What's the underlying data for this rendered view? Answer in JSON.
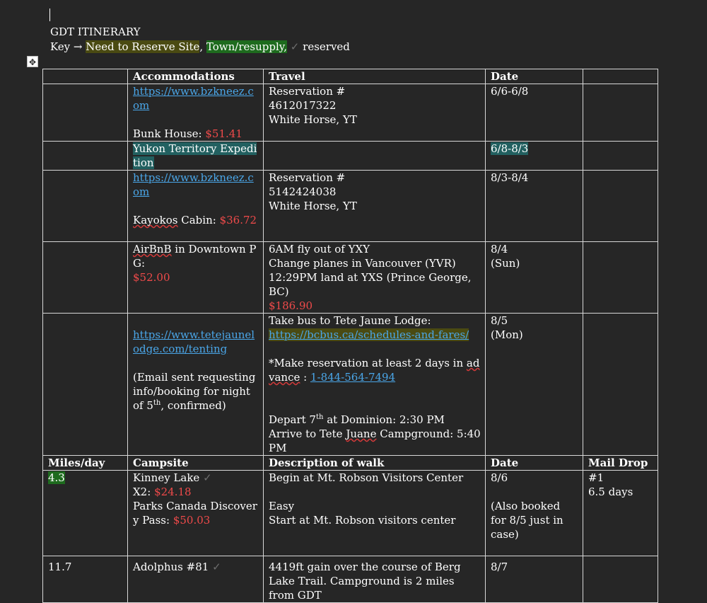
{
  "doc": {
    "title": "GDT ITINERARY",
    "key_prefix": "Key → ",
    "key_reserve": "Need to Reserve Site",
    "key_town": "Town/resupply,",
    "key_check": "✓",
    "key_reserved": "reserved",
    "comma": ","
  },
  "headers1": {
    "col2": "Accommodations",
    "col3": "Travel",
    "col4": "Date"
  },
  "rows1": [
    {
      "accom_link": "https://www.bzkneez.com",
      "accom_label": "Bunk House:",
      "accom_price": "$51.41",
      "travel": [
        "Reservation #",
        "4612017322",
        "White Horse, YT"
      ],
      "date": "6/6-6/8"
    },
    {
      "accom_hl": "Yukon Territory Expedition",
      "date_hl": "6/8-8/3"
    },
    {
      "accom_link": "https://www.bzkneez.com",
      "accom_label_squig": "Kayokos",
      "accom_label_rest": " Cabin:",
      "accom_price": "$36.72",
      "travel": [
        "Reservation #",
        "5142424038",
        "White Horse, YT"
      ],
      "date": "8/3-8/4"
    },
    {
      "accom_squig": "AirBnB",
      "accom_rest": " in Downtown PG:",
      "accom_price": "$52.00",
      "travel": [
        "6AM fly out of YXY",
        "Change planes in Vancouver (YVR)",
        "12:29PM land at YXS (Prince George, BC)"
      ],
      "travel_price": "$186.90",
      "date": [
        "8/4",
        "(Sun)"
      ]
    },
    {
      "accom_link": "https://www.tetejaunelodge.com/tenting",
      "accom_note": "(Email sent requesting info/booking for night of 5",
      "accom_note_sup": "th",
      "accom_note_end": ", confirmed)",
      "travel_line1": "Take bus to Tete Jaune Lodge:",
      "travel_link": "https://bcbus.ca/schedules-and-fares/",
      "travel_note": "*Make reservation at least 2 days in ",
      "travel_note_squig": "advance",
      "travel_note_colon": " : ",
      "travel_phone": "1-844-564-7494",
      "depart_a": "Depart 7",
      "depart_sup": "th",
      "depart_b": " at Dominion: 2:30 PM",
      "arrive_a": "Arrive to Tete ",
      "arrive_squig": "Juane",
      "arrive_b": " Campground: 5:40PM",
      "date": [
        "8/5",
        "(Mon)"
      ]
    }
  ],
  "headers2": {
    "col1": "Miles/day",
    "col2": "Campsite",
    "col3": "Description of walk",
    "col4": "Date",
    "col5": "Mail Drop"
  },
  "rows2": [
    {
      "miles": "4.3",
      "camp_name": "Kinney Lake ",
      "camp_check": "✓",
      "camp_x2": "X2:",
      "camp_x2_price": "$24.18",
      "camp_parks": "Parks Canada Discovery Pass:",
      "camp_parks_price": "$50.03",
      "desc": [
        "Begin at Mt. Robson Visitors Center",
        "",
        "Easy",
        "Start at Mt. Robson visitors center"
      ],
      "date": [
        "8/6",
        "",
        "(Also booked for 8/5 just in case)"
      ],
      "mail": [
        "#1",
        "6.5 days"
      ]
    },
    {
      "miles": "11.7",
      "camp_name": "Adolphus #81 ",
      "camp_check": "✓",
      "desc": "4419ft gain over the course of Berg Lake Trail. Campground is 2 miles from GDT",
      "date": "8/7"
    }
  ]
}
